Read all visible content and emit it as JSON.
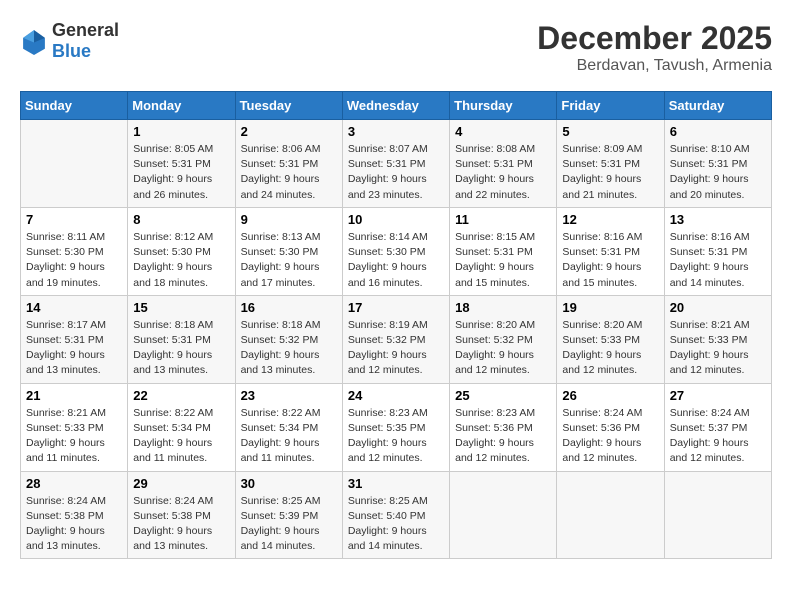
{
  "header": {
    "logo_general": "General",
    "logo_blue": "Blue",
    "month_year": "December 2025",
    "location": "Berdavan, Tavush, Armenia"
  },
  "days_of_week": [
    "Sunday",
    "Monday",
    "Tuesday",
    "Wednesday",
    "Thursday",
    "Friday",
    "Saturday"
  ],
  "weeks": [
    [
      {
        "day": "",
        "detail": ""
      },
      {
        "day": "1",
        "detail": "Sunrise: 8:05 AM\nSunset: 5:31 PM\nDaylight: 9 hours\nand 26 minutes."
      },
      {
        "day": "2",
        "detail": "Sunrise: 8:06 AM\nSunset: 5:31 PM\nDaylight: 9 hours\nand 24 minutes."
      },
      {
        "day": "3",
        "detail": "Sunrise: 8:07 AM\nSunset: 5:31 PM\nDaylight: 9 hours\nand 23 minutes."
      },
      {
        "day": "4",
        "detail": "Sunrise: 8:08 AM\nSunset: 5:31 PM\nDaylight: 9 hours\nand 22 minutes."
      },
      {
        "day": "5",
        "detail": "Sunrise: 8:09 AM\nSunset: 5:31 PM\nDaylight: 9 hours\nand 21 minutes."
      },
      {
        "day": "6",
        "detail": "Sunrise: 8:10 AM\nSunset: 5:31 PM\nDaylight: 9 hours\nand 20 minutes."
      }
    ],
    [
      {
        "day": "7",
        "detail": "Sunrise: 8:11 AM\nSunset: 5:30 PM\nDaylight: 9 hours\nand 19 minutes."
      },
      {
        "day": "8",
        "detail": "Sunrise: 8:12 AM\nSunset: 5:30 PM\nDaylight: 9 hours\nand 18 minutes."
      },
      {
        "day": "9",
        "detail": "Sunrise: 8:13 AM\nSunset: 5:30 PM\nDaylight: 9 hours\nand 17 minutes."
      },
      {
        "day": "10",
        "detail": "Sunrise: 8:14 AM\nSunset: 5:30 PM\nDaylight: 9 hours\nand 16 minutes."
      },
      {
        "day": "11",
        "detail": "Sunrise: 8:15 AM\nSunset: 5:31 PM\nDaylight: 9 hours\nand 15 minutes."
      },
      {
        "day": "12",
        "detail": "Sunrise: 8:16 AM\nSunset: 5:31 PM\nDaylight: 9 hours\nand 15 minutes."
      },
      {
        "day": "13",
        "detail": "Sunrise: 8:16 AM\nSunset: 5:31 PM\nDaylight: 9 hours\nand 14 minutes."
      }
    ],
    [
      {
        "day": "14",
        "detail": "Sunrise: 8:17 AM\nSunset: 5:31 PM\nDaylight: 9 hours\nand 13 minutes."
      },
      {
        "day": "15",
        "detail": "Sunrise: 8:18 AM\nSunset: 5:31 PM\nDaylight: 9 hours\nand 13 minutes."
      },
      {
        "day": "16",
        "detail": "Sunrise: 8:18 AM\nSunset: 5:32 PM\nDaylight: 9 hours\nand 13 minutes."
      },
      {
        "day": "17",
        "detail": "Sunrise: 8:19 AM\nSunset: 5:32 PM\nDaylight: 9 hours\nand 12 minutes."
      },
      {
        "day": "18",
        "detail": "Sunrise: 8:20 AM\nSunset: 5:32 PM\nDaylight: 9 hours\nand 12 minutes."
      },
      {
        "day": "19",
        "detail": "Sunrise: 8:20 AM\nSunset: 5:33 PM\nDaylight: 9 hours\nand 12 minutes."
      },
      {
        "day": "20",
        "detail": "Sunrise: 8:21 AM\nSunset: 5:33 PM\nDaylight: 9 hours\nand 12 minutes."
      }
    ],
    [
      {
        "day": "21",
        "detail": "Sunrise: 8:21 AM\nSunset: 5:33 PM\nDaylight: 9 hours\nand 11 minutes."
      },
      {
        "day": "22",
        "detail": "Sunrise: 8:22 AM\nSunset: 5:34 PM\nDaylight: 9 hours\nand 11 minutes."
      },
      {
        "day": "23",
        "detail": "Sunrise: 8:22 AM\nSunset: 5:34 PM\nDaylight: 9 hours\nand 11 minutes."
      },
      {
        "day": "24",
        "detail": "Sunrise: 8:23 AM\nSunset: 5:35 PM\nDaylight: 9 hours\nand 12 minutes."
      },
      {
        "day": "25",
        "detail": "Sunrise: 8:23 AM\nSunset: 5:36 PM\nDaylight: 9 hours\nand 12 minutes."
      },
      {
        "day": "26",
        "detail": "Sunrise: 8:24 AM\nSunset: 5:36 PM\nDaylight: 9 hours\nand 12 minutes."
      },
      {
        "day": "27",
        "detail": "Sunrise: 8:24 AM\nSunset: 5:37 PM\nDaylight: 9 hours\nand 12 minutes."
      }
    ],
    [
      {
        "day": "28",
        "detail": "Sunrise: 8:24 AM\nSunset: 5:38 PM\nDaylight: 9 hours\nand 13 minutes."
      },
      {
        "day": "29",
        "detail": "Sunrise: 8:24 AM\nSunset: 5:38 PM\nDaylight: 9 hours\nand 13 minutes."
      },
      {
        "day": "30",
        "detail": "Sunrise: 8:25 AM\nSunset: 5:39 PM\nDaylight: 9 hours\nand 14 minutes."
      },
      {
        "day": "31",
        "detail": "Sunrise: 8:25 AM\nSunset: 5:40 PM\nDaylight: 9 hours\nand 14 minutes."
      },
      {
        "day": "",
        "detail": ""
      },
      {
        "day": "",
        "detail": ""
      },
      {
        "day": "",
        "detail": ""
      }
    ]
  ]
}
